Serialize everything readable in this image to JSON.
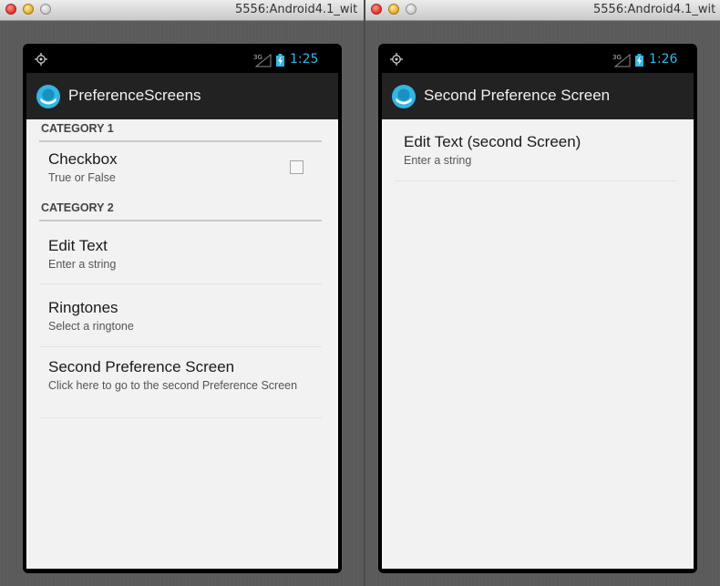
{
  "left_window": {
    "title": "5556:Android4.1_wit",
    "status": {
      "network": "3G",
      "time": "1:25"
    },
    "action_bar": {
      "title": "PreferenceScreens"
    },
    "categories": [
      {
        "label": "CATEGORY 1"
      },
      {
        "label": "CATEGORY 2"
      }
    ],
    "checkbox_pref": {
      "title": "Checkbox",
      "summary": "True or False",
      "checked": false
    },
    "prefs": [
      {
        "title": "Edit Text",
        "summary": "Enter a string"
      },
      {
        "title": "Ringtones",
        "summary": "Select a ringtone"
      },
      {
        "title": "Second Preference Screen",
        "summary": "Click here to go to the second Preference Screen"
      }
    ]
  },
  "right_window": {
    "title": "5556:Android4.1_wit",
    "status": {
      "network": "3G",
      "time": "1:26"
    },
    "action_bar": {
      "title": "Second Preference Screen"
    },
    "prefs": [
      {
        "title": "Edit Text (second Screen)",
        "summary": "Enter a string"
      }
    ]
  },
  "colors": {
    "clock": "#33b5e5",
    "action_bar": "#222222",
    "app_icon": "#33b5e5",
    "content_bg": "#f2f2f2"
  }
}
